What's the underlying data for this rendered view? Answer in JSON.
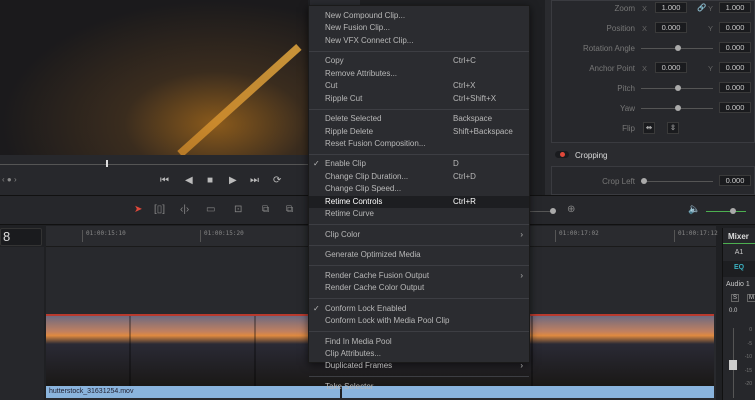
{
  "viewer": {
    "nav": "‹ ● ›"
  },
  "transport": {
    "buttons": [
      "⏮",
      "◀",
      "■",
      "▶",
      "⏭",
      "⟳"
    ]
  },
  "timeline": {
    "timecode": "8",
    "ticks": [
      "01:00:15:10",
      "01:00:15:20",
      "01:00:17:02",
      "01:00:17:12"
    ],
    "clip_name": "hutterstock_31631254.mov"
  },
  "inspector": {
    "zoom": {
      "label": "Zoom",
      "x": "1.000",
      "y": "1.000"
    },
    "position": {
      "label": "Position",
      "x": "0.000",
      "y": "0.000"
    },
    "rotation": {
      "label": "Rotation Angle",
      "value": "0.000"
    },
    "anchor": {
      "label": "Anchor Point",
      "x": "0.000",
      "y": "0.000"
    },
    "pitch": {
      "label": "Pitch",
      "value": "0.000"
    },
    "yaw": {
      "label": "Yaw",
      "value": "0.000"
    },
    "flip": {
      "label": "Flip"
    },
    "axis_x": "X",
    "axis_y": "Y",
    "cropping": {
      "label": "Cropping",
      "crop_left_label": "Crop Left",
      "crop_left": "0.000"
    }
  },
  "mixer": {
    "title": "Mixer",
    "channel": "A1",
    "eq": "EQ",
    "track": "Audio 1",
    "solo": "S",
    "mute": "M",
    "level": "0.0",
    "scale": [
      "0",
      "-5",
      "-10",
      "-15",
      "-20"
    ]
  },
  "menu": {
    "groups": [
      [
        {
          "label": "New Compound Clip..."
        },
        {
          "label": "New Fusion Clip..."
        },
        {
          "label": "New VFX Connect Clip..."
        }
      ],
      [
        {
          "label": "Copy",
          "shortcut": "Ctrl+C"
        },
        {
          "label": "Remove Attributes..."
        },
        {
          "label": "Cut",
          "shortcut": "Ctrl+X"
        },
        {
          "label": "Ripple Cut",
          "shortcut": "Ctrl+Shift+X"
        }
      ],
      [
        {
          "label": "Delete Selected",
          "shortcut": "Backspace"
        },
        {
          "label": "Ripple Delete",
          "shortcut": "Shift+Backspace"
        },
        {
          "label": "Reset Fusion Composition..."
        }
      ],
      [
        {
          "label": "Enable Clip",
          "shortcut": "D",
          "checked": "✓"
        },
        {
          "label": "Change Clip Duration...",
          "shortcut": "Ctrl+D"
        },
        {
          "label": "Change Clip Speed..."
        },
        {
          "label": "Retime Controls",
          "shortcut": "Ctrl+R",
          "highlighted": true
        },
        {
          "label": "Retime Curve"
        }
      ],
      [
        {
          "label": "Clip Color",
          "submenu": "›"
        }
      ],
      [
        {
          "label": "Generate Optimized Media"
        }
      ],
      [
        {
          "label": "Render Cache Fusion Output",
          "submenu": "›"
        },
        {
          "label": "Render Cache Color Output"
        }
      ],
      [
        {
          "label": "Conform Lock Enabled",
          "checked": "✓"
        },
        {
          "label": "Conform Lock with Media Pool Clip"
        }
      ],
      [
        {
          "label": "Find In Media Pool"
        },
        {
          "label": "Clip Attributes..."
        },
        {
          "label": "Duplicated Frames",
          "submenu": "›"
        }
      ],
      [
        {
          "label": "Take Selector"
        }
      ]
    ]
  },
  "colors": {
    "accent_red": "#e0483a",
    "clip_audio": "#8ab4dd",
    "eq": "#3ab0c0",
    "volume": "#4caf50"
  }
}
